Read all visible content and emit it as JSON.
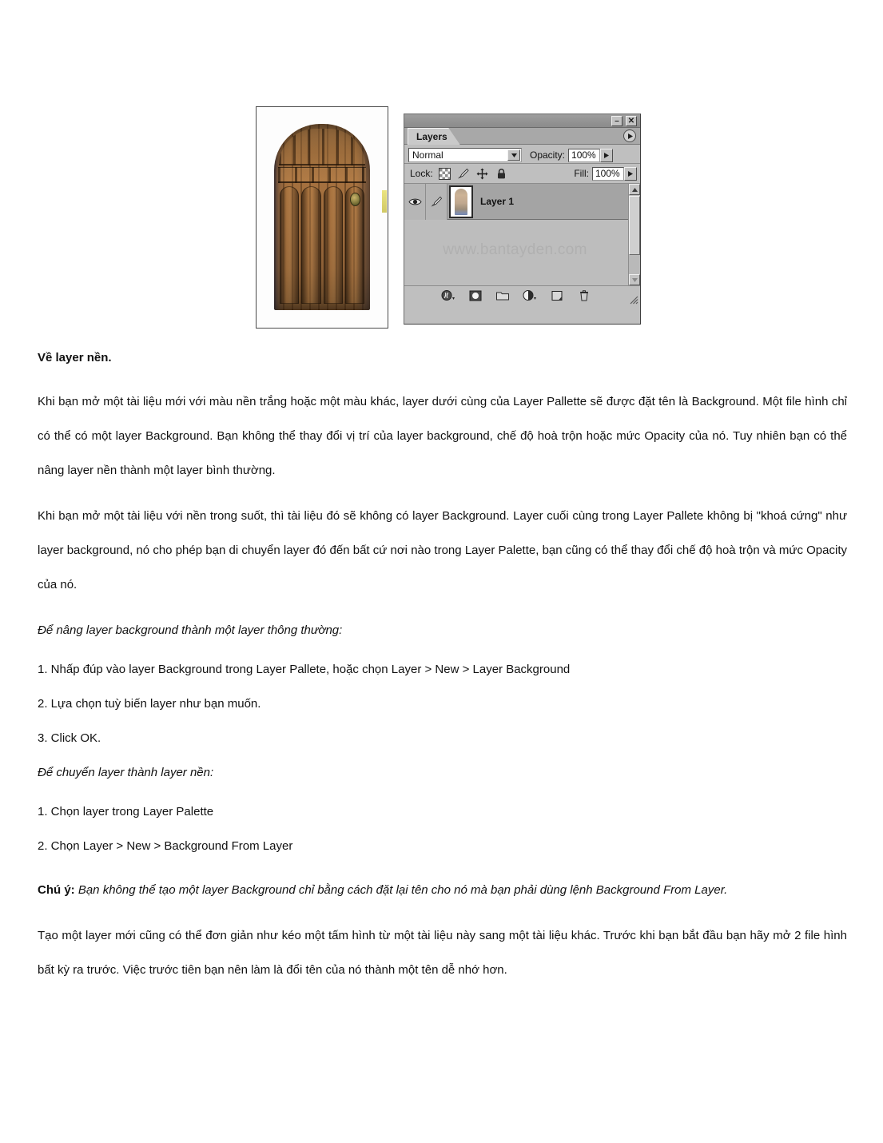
{
  "figure": {
    "door_photo": {
      "alt_name": "ornate-arched-wooden-door-photo"
    },
    "layers_palette": {
      "window_buttons": {
        "minimize": "–",
        "close": "✕"
      },
      "tab_label": "Layers",
      "menu_arrow": "palette-menu-arrow",
      "blend_mode": "Normal",
      "opacity_label": "Opacity:",
      "opacity_value": "100%",
      "lock_label": "Lock:",
      "lock_icons": [
        "lock-transparent-pixels-icon",
        "lock-image-pixels-icon",
        "lock-position-icon",
        "lock-all-icon"
      ],
      "fill_label": "Fill:",
      "fill_value": "100%",
      "layers": [
        {
          "name": "Layer 1",
          "visible": true,
          "thumbnail": "door-layer-thumbnail",
          "selected": true
        }
      ],
      "watermark": "www.bantayden.com",
      "footer_icons": [
        "layer-style-fx-icon",
        "add-layer-mask-icon",
        "new-group-folder-icon",
        "new-adjustment-layer-icon",
        "new-layer-icon",
        "delete-layer-trash-icon"
      ]
    }
  },
  "document": {
    "heading": "Về layer nền.",
    "paragraph_1": "Khi bạn mở một tài liệu mới với màu nền trắng hoặc một màu khác, layer dưới cùng của Layer Pallette sẽ được đặt tên là Background. Một file hình chỉ có thể có một layer Background. Bạn không thể thay đổi vị trí của layer background, chế độ hoà trộn hoặc mức Opacity của nó. Tuy nhiên bạn có thể nâng layer nền thành một layer bình thường.",
    "paragraph_2": "Khi bạn mở một tài liệu với nền trong suốt, thì tài liệu đó sẽ không có layer Background. Layer cuối cùng trong Layer Pallete không bị \"khoá cứng\" như layer background, nó cho phép bạn di chuyển layer đó đến bất cứ nơi nào trong Layer Palette, bạn cũng có thể thay đổi chế độ hoà trộn và mức Opacity của nó.",
    "subheading_1": "Để nâng layer background thành một layer thông thường:",
    "steps_1": [
      "1. Nhấp đúp vào layer Background trong Layer Pallete, hoặc chọn Layer > New > Layer Background",
      "2. Lựa chọn tuỳ biến layer như bạn muốn.",
      "3. Click OK."
    ],
    "subheading_2": "Để chuyển layer thành layer nền:",
    "steps_2": [
      "1. Chọn layer trong Layer Palette",
      "2. Chọn Layer > New > Background From Layer"
    ],
    "note_label": "Chú ý:",
    "note_text": " Bạn không thể tạo một layer Background chỉ bằng cách đặt lại tên cho nó mà bạn phải dùng lệnh Background From Layer.",
    "paragraph_3": "Tạo một layer mới cũng có thể đơn giản như kéo một tấm hình từ một tài liệu này sang một tài liệu khác. Trước khi bạn bắt đầu bạn hãy mở 2 file hình bất kỳ ra trước. Việc trước tiên bạn nên làm là đổi tên của nó thành một tên dễ nhớ hơn."
  }
}
